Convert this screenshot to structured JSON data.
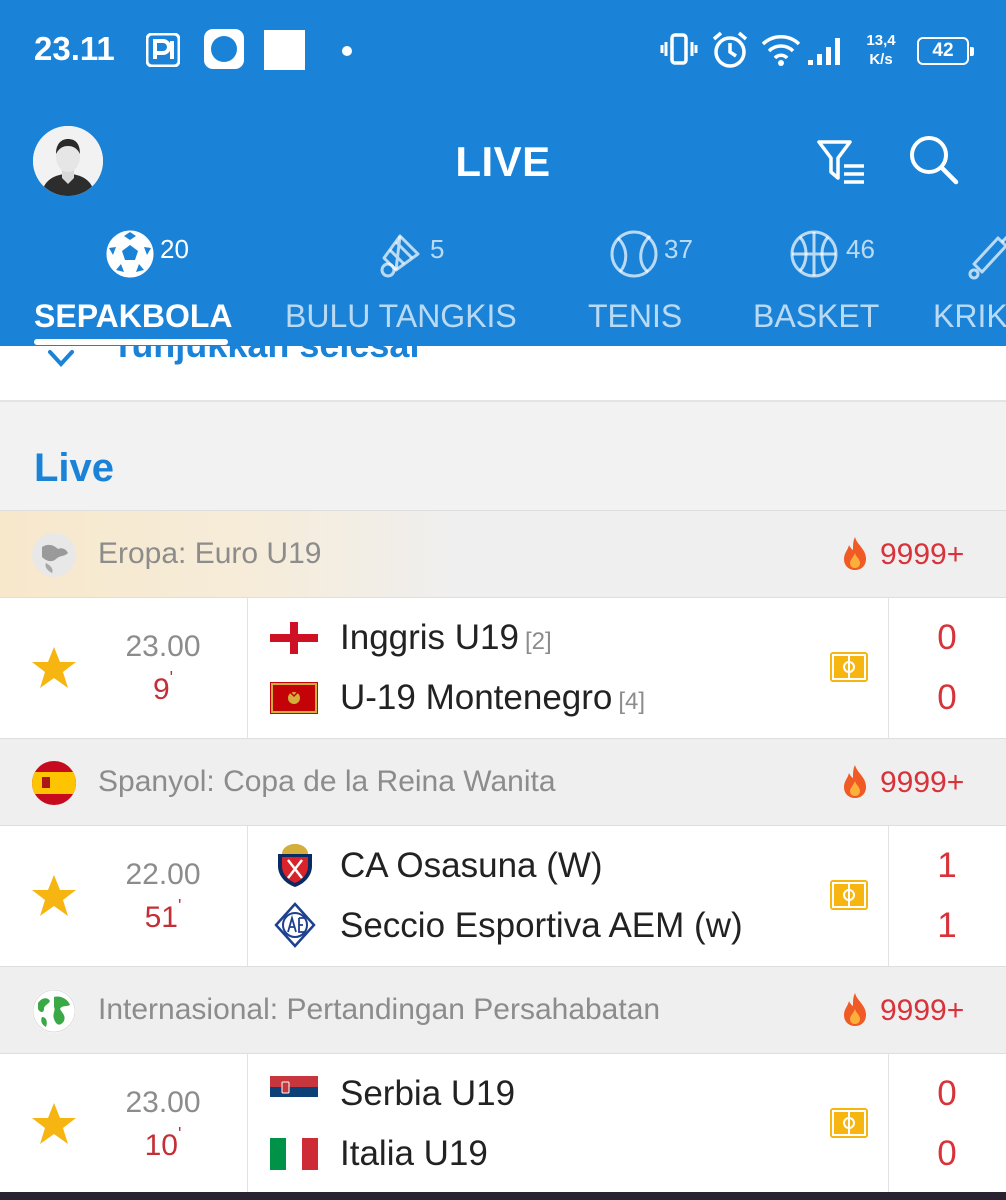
{
  "status_bar": {
    "time": "23.11",
    "network_speed_value": "13,4",
    "network_speed_unit": "K/s",
    "battery": "42"
  },
  "header": {
    "title": "LIVE"
  },
  "tabs": [
    {
      "label": "SEPAKBOLA",
      "count": "20",
      "icon": "soccer-ball-icon",
      "active": true
    },
    {
      "label": "BULU TANGKIS",
      "count": "5",
      "icon": "shuttlecock-icon",
      "active": false
    },
    {
      "label": "TENIS",
      "count": "37",
      "icon": "tennis-ball-icon",
      "active": false
    },
    {
      "label": "BASKET",
      "count": "46",
      "icon": "basketball-icon",
      "active": false
    },
    {
      "label": "KRIK",
      "count": "",
      "icon": "cricket-bat-icon",
      "active": false
    }
  ],
  "show_finished": "Tunjukkan selesai",
  "section_heading": "Live",
  "colors": {
    "brand_blue": "#1a83d8",
    "live_red": "#d8323a",
    "star_yellow": "#f6b511"
  },
  "leagues": [
    {
      "name": "Eropa: Euro U19",
      "viewers": "9999+",
      "flag": "globe-europe-icon",
      "match": {
        "time": "23.00",
        "minute": "9",
        "home": {
          "name": "Inggris U19",
          "rank": "[2]",
          "flag": "england-flag"
        },
        "away": {
          "name": "U-19 Montenegro",
          "rank": "[4]",
          "flag": "montenegro-flag"
        },
        "home_score": "0",
        "away_score": "0"
      }
    },
    {
      "name": "Spanyol: Copa de la Reina Wanita",
      "viewers": "9999+",
      "flag": "spain-flag",
      "match": {
        "time": "22.00",
        "minute": "51",
        "home": {
          "name": "CA Osasuna (W)",
          "rank": "",
          "flag": "osasuna-crest"
        },
        "away": {
          "name": "Seccio Esportiva AEM (w)",
          "rank": "",
          "flag": "aem-crest"
        },
        "home_score": "1",
        "away_score": "1"
      }
    },
    {
      "name": "Internasional: Pertandingan Persahabatan",
      "viewers": "9999+",
      "flag": "globe-world-icon",
      "match": {
        "time": "23.00",
        "minute": "10",
        "home": {
          "name": "Serbia U19",
          "rank": "",
          "flag": "serbia-flag"
        },
        "away": {
          "name": "Italia U19",
          "rank": "",
          "flag": "italy-flag"
        },
        "home_score": "0",
        "away_score": "0"
      }
    }
  ]
}
